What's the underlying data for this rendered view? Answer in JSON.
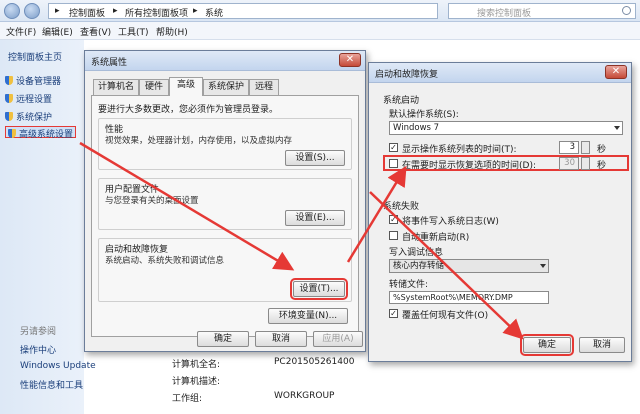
{
  "address": {
    "crumb1": "控制面板",
    "crumb2": "所有控制面板项",
    "crumb3": "系统",
    "search_placeholder": "搜索控制面板"
  },
  "menu": {
    "file": "文件(F)",
    "edit": "编辑(E)",
    "view": "查看(V)",
    "tools": "工具(T)",
    "help": "帮助(H)"
  },
  "sidebar": {
    "title": "控制面板主页",
    "items": [
      "设备管理器",
      "远程设置",
      "系统保护",
      "高级系统设置"
    ],
    "see_also": "另请参阅",
    "footer": [
      "操作中心",
      "Windows Update",
      "性能信息和工具"
    ]
  },
  "computer_info": {
    "full_name_label": "计算机全名:",
    "full_name_value": "PC201505261400",
    "description_label": "计算机描述:",
    "workgroup_label": "工作组:",
    "workgroup_value": "WORKGROUP"
  },
  "sysprops": {
    "title": "系统属性",
    "tabs": [
      "计算机名",
      "硬件",
      "高级",
      "系统保护",
      "远程"
    ],
    "active_tab": "高级",
    "admin_note": "要进行大多数更改，您必须作为管理员登录。",
    "performance": {
      "label": "性能",
      "desc": "视觉效果，处理器计划，内存使用，以及虚拟内存",
      "button": "设置(S)..."
    },
    "profiles": {
      "label": "用户配置文件",
      "desc": "与您登录有关的桌面设置",
      "button": "设置(E)..."
    },
    "startup": {
      "label": "启动和故障恢复",
      "desc": "系统启动、系统失败和调试信息",
      "button": "设置(T)..."
    },
    "env_button": "环境变量(N)...",
    "ok": "确定",
    "cancel": "取消",
    "apply": "应用(A)"
  },
  "startup_dialog": {
    "title": "启动和故障恢复",
    "system_startup": "系统启动",
    "default_os_label": "默认操作系统(S):",
    "default_os_value": "Windows 7",
    "show_list_label": "显示操作系统列表的时间(T):",
    "show_list_value": "3",
    "show_recovery_label": "在需要时显示恢复选项的时间(D):",
    "show_recovery_value": "30",
    "seconds": "秒",
    "system_failure": "系统失败",
    "write_event_label": "将事件写入系统日志(W)",
    "auto_restart_label": "自动重新启动(R)",
    "debug_info_label": "写入调试信息",
    "debug_select_value": "核心内存转储",
    "dump_file_label": "转储文件:",
    "dump_file_value": "%SystemRoot%\\MEMORY.DMP",
    "overwrite_label": "覆盖任何现有文件(O)",
    "ok": "确定",
    "cancel": "取消"
  }
}
